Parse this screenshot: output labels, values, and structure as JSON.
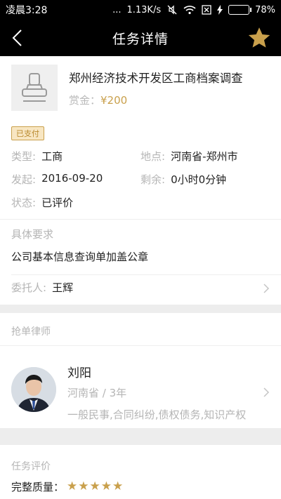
{
  "status_bar": {
    "time": "凌晨3:28",
    "dots": "...",
    "speed": "1.13K/s",
    "battery_percent": "78%",
    "battery_level": 0.78
  },
  "nav": {
    "title": "任务详情",
    "back_icon": "chevron-left-icon",
    "favorite_icon": "star-icon",
    "accent_color": "#c9a04c"
  },
  "task": {
    "title": "郑州经济技术开发区工商档案调查",
    "reward_label": "赏金：",
    "reward_amount": "¥200",
    "paid_badge": "已支付",
    "info": {
      "type_label": "类型:",
      "type_value": "工商",
      "location_label": "地点:",
      "location_value": "河南省-郑州市",
      "start_label": "发起:",
      "start_value": "2016-09-20",
      "remaining_label": "剩余:",
      "remaining_value": "0小时0分钟",
      "status_label": "状态:",
      "status_value": "已评价"
    },
    "requirement_label": "具体要求",
    "requirement_text": "公司基本信息查询单加盖公章",
    "client_label": "委托人:",
    "client_name": "王辉"
  },
  "lawyer_section": {
    "label": "抢单律师",
    "name": "刘阳",
    "meta": "河南省 / 3年",
    "specialties": "一般民事,合同纠纷,债权债务,知识产权"
  },
  "evaluation": {
    "label": "任务评价",
    "quality_label": "完整质量：",
    "quality_rating": 5
  }
}
